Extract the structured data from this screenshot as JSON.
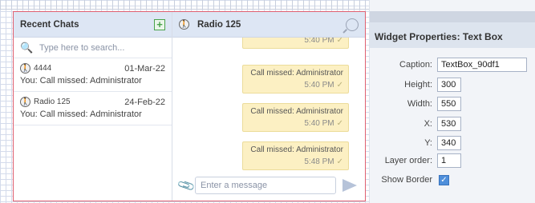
{
  "chat_list": {
    "title": "Recent Chats",
    "add_icon": "plus-icon",
    "search_placeholder": "Type here to search...",
    "items": [
      {
        "name": "4444",
        "date": "01-Mar-22",
        "preview": "You: Call missed: Administrator"
      },
      {
        "name": "Radio 125",
        "date": "24-Feb-22",
        "preview": "You: Call missed: Administrator"
      }
    ]
  },
  "conversation": {
    "title": "Radio 125",
    "messages": [
      {
        "text": "Call missed: Administrator",
        "time": "5:40 PM"
      },
      {
        "text": "Call missed: Administrator",
        "time": "5:40 PM"
      },
      {
        "text": "Call missed: Administrator",
        "time": "5:48 PM"
      }
    ],
    "compose_placeholder": "Enter a message"
  },
  "properties": {
    "title": "Widget Properties: Text Box",
    "caption_label": "Caption:",
    "caption_value": "TextBox_90df1",
    "height_label": "Height:",
    "height_value": "300",
    "width_label": "Width:",
    "width_value": "550",
    "x_label": "X:",
    "x_value": "530",
    "y_label": "Y:",
    "y_value": "340",
    "layer_label": "Layer order:",
    "layer_value": "1",
    "border_label": "Show Border",
    "border_checked": true
  },
  "colors": {
    "selection_border": "#e06070",
    "header_bg": "#dde6f4",
    "bubble_bg": "#fcf0c3",
    "checkbox_blue": "#4f8fdb"
  }
}
